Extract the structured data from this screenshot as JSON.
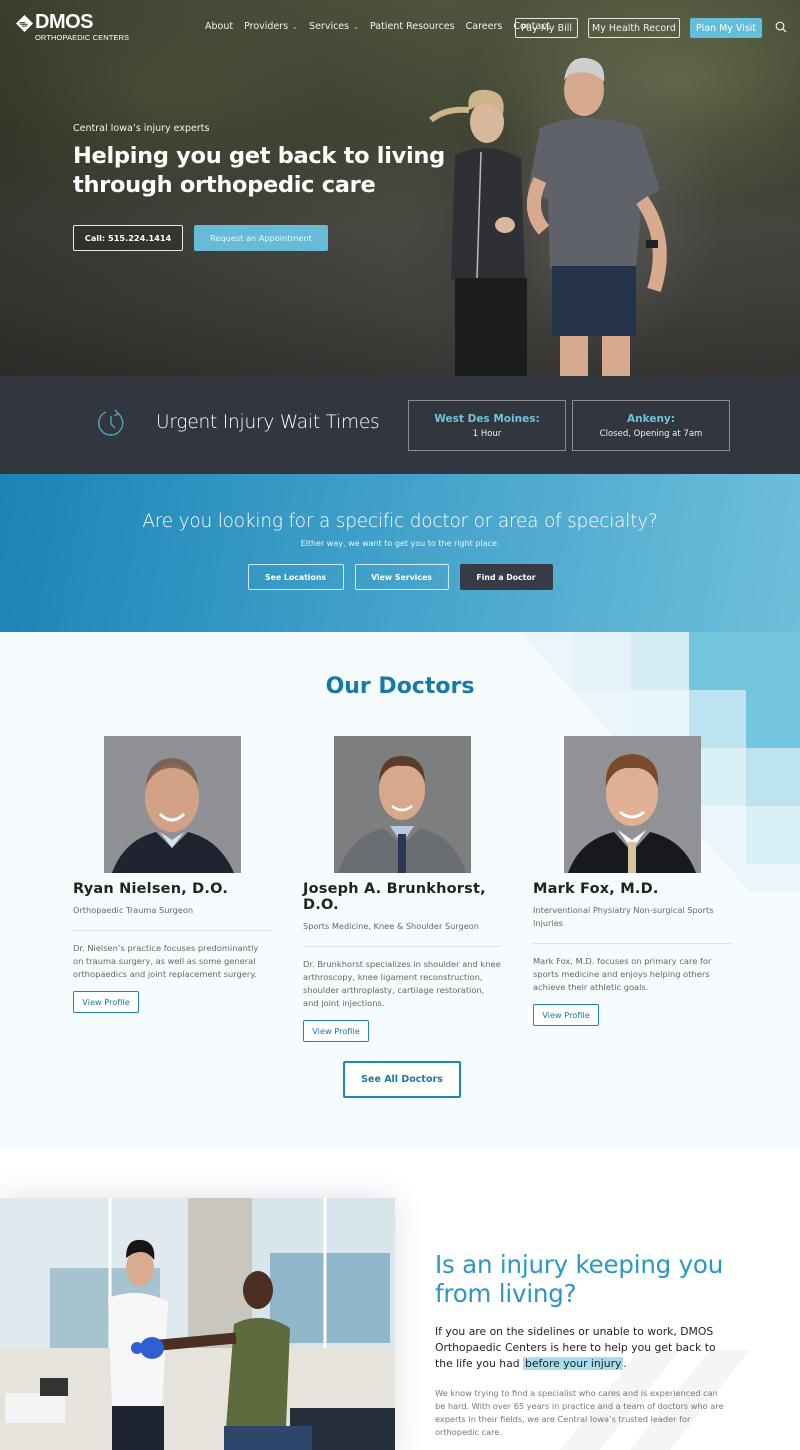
{
  "brand": {
    "name": "DMOS",
    "subtitle": "ORTHOPAEDIC CENTERS"
  },
  "nav": {
    "links": [
      {
        "label": "About",
        "dropdown": false
      },
      {
        "label": "Providers",
        "dropdown": true
      },
      {
        "label": "Services",
        "dropdown": true
      },
      {
        "label": "Patient Resources",
        "dropdown": false
      },
      {
        "label": "Careers",
        "dropdown": false
      },
      {
        "label": "Contact",
        "dropdown": false
      }
    ],
    "pay_bill": "Pay My Bill",
    "health_record": "My Health Record",
    "plan_visit": "Plan My Visit",
    "search_icon": "search-icon",
    "chevron": "⌄"
  },
  "hero": {
    "eyebrow": "Central Iowa’s injury experts",
    "title": "Helping you get back to living through orthopedic care",
    "call_label": "Call: 515.224.1414",
    "appointment_label": "Request an Appointment"
  },
  "wait_times": {
    "icon": "clock-refresh-icon",
    "title": "Urgent Injury Wait Times",
    "locations": [
      {
        "name": "West Des Moines:",
        "value": "1 Hour"
      },
      {
        "name": "Ankeny:",
        "value": "Closed, Opening at 7am"
      }
    ]
  },
  "specialty": {
    "title": "Are you looking for a specific doctor or area of specialty?",
    "subtitle": "Either way, we want to get you to the right place.",
    "buttons": {
      "locations": "See Locations",
      "services": "View Services",
      "find_doctor": "Find a Doctor"
    }
  },
  "doctors": {
    "title": "Our Doctors",
    "items": [
      {
        "name": "Ryan Nielsen, D.O.",
        "specialty": "Orthopaedic Trauma Surgeon",
        "description": "Dr. Nielsen’s practice focuses predominantly on trauma surgery, as well as some general orthopaedics and joint replacement surgery.",
        "button": "View Profile"
      },
      {
        "name": "Joseph A. Brunkhorst, D.O.",
        "specialty": "Sports Medicine, Knee & Shoulder Surgeon",
        "description": "Dr. Brunkhorst specializes in shoulder and knee arthroscopy, knee ligament reconstruction, shoulder arthroplasty, cartilage restoration, and joint injections.",
        "button": "View Profile"
      },
      {
        "name": "Mark Fox, M.D.",
        "specialty": "Interventional Physiatry Non-surgical Sports Injuries",
        "description": "Mark Fox, M.D. focuses on primary care for sports medicine and enjoys helping others achieve their athletic goals.",
        "button": "View Profile"
      }
    ],
    "see_all": "See All Doctors"
  },
  "injury": {
    "title": "Is an injury keeping you from living?",
    "lead_before": "If you are on the sidelines or unable to work, DMOS Orthopaedic Centers is here to help you get back to the life you had ",
    "lead_highlight": "before your injury",
    "lead_after": ".",
    "body": "We know trying to find a specialist who cares and is experienced can be hard. With over 65 years in practice and a team of doctors who are experts in their fields, we are Central Iowa’s trusted leader for orthopedic care."
  },
  "colors": {
    "accent": "#62bed9",
    "primary_blue": "#1779a8",
    "dark": "#32363f",
    "find_doctor_bg": "#363c47",
    "highlight": "#a8def0"
  }
}
